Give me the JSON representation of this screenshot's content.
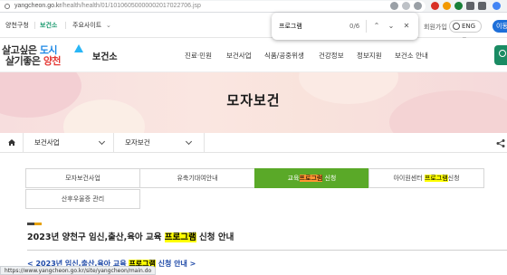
{
  "browser": {
    "url_host": "yangcheon.go.kr",
    "url_path": "/health/health/01/10106050000002017022706.jsp"
  },
  "find_bar": {
    "query": "프로그램",
    "count": "0/6",
    "prev_label": "⌃",
    "next_label": "⌄",
    "close_label": "✕"
  },
  "util_bar": {
    "items": [
      "양천구청",
      "보건소",
      "주요사이트"
    ],
    "login_label": "회원가입",
    "lang_label": "ENG",
    "login_button": "이동"
  },
  "header": {
    "logo_line1_a": "살고싶은 ",
    "logo_line1_b": "도시",
    "logo_line2_a": "살기좋은 ",
    "logo_line2_b": "양천",
    "site_title": "보건소",
    "nav": [
      "진료·민원",
      "보건사업",
      "식품/공중위생",
      "건강정보",
      "정보지원",
      "보건소 안내"
    ]
  },
  "banner": {
    "title": "모자보건"
  },
  "location": {
    "depth1": "보건사업",
    "depth2": "모자보건"
  },
  "tabs": [
    {
      "label": "모자보건사업"
    },
    {
      "label": "유축기대여안내"
    },
    {
      "pre": "교육",
      "hl": "프로그램",
      "post": " 신청"
    },
    {
      "pre": "아이원센터 ",
      "hl": "프로그램",
      "post": "신청"
    },
    {
      "label": "산후우울증 관리"
    }
  ],
  "content": {
    "title_pre": "2023년 양천구 임신,출산,육아 교육 ",
    "title_hl": "프로그램",
    "title_post": " 신청 안내",
    "link_pre": "< 2023년 임신,출산,육아 교육 ",
    "link_hl": "프로그램",
    "link_post": " 신청 안내 >"
  },
  "status": {
    "url": "https://www.yangcheon.go.kr/site/yangcheon/main.do"
  },
  "colors": {
    "accent_green": "#5aa928",
    "link_blue": "#1f4aa8",
    "highlight_yellow": "#ffff00",
    "highlight_orange": "#ff9632"
  }
}
